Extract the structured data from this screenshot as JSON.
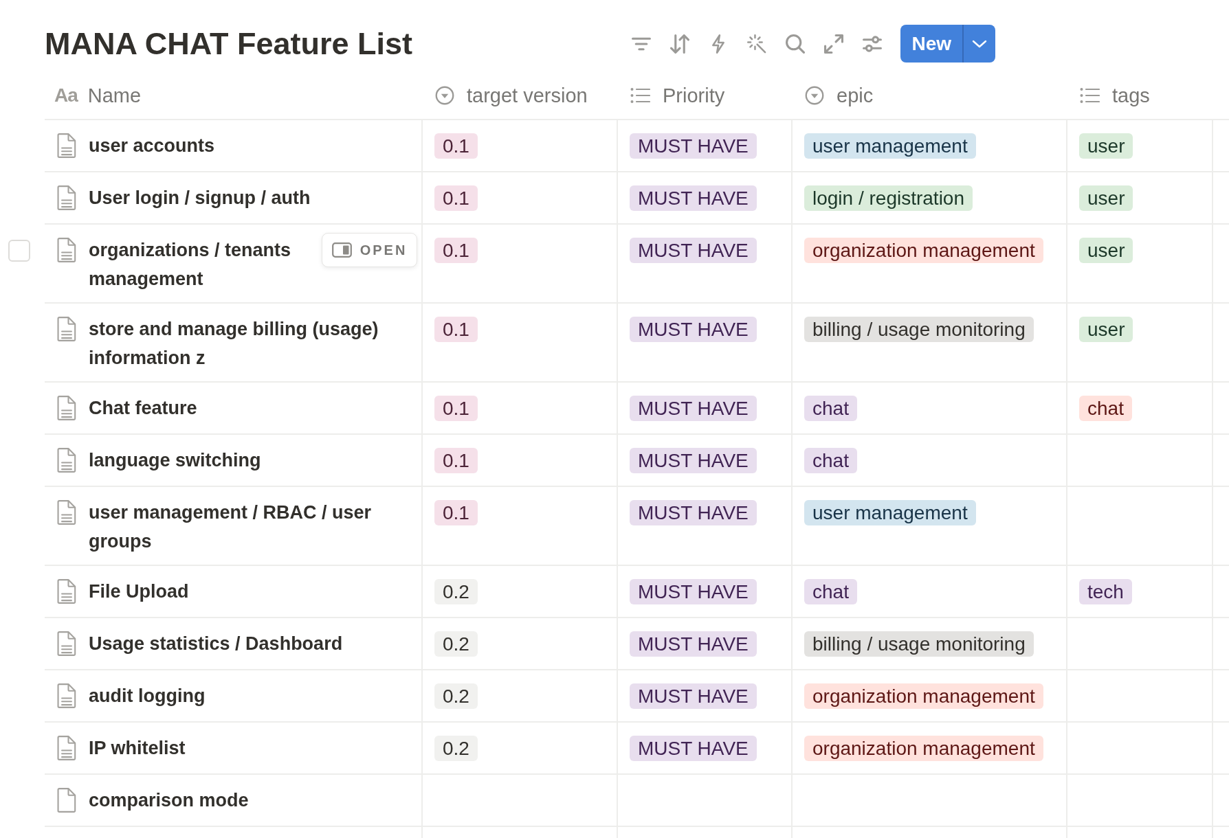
{
  "title": "MANA CHAT Feature List",
  "new_button": {
    "label": "New"
  },
  "open_button_label": "OPEN",
  "columns": [
    {
      "label": "Name",
      "kind": "title",
      "icon_glyph": "Aa"
    },
    {
      "label": "target version",
      "kind": "select"
    },
    {
      "label": "Priority",
      "kind": "multi_select"
    },
    {
      "label": "epic",
      "kind": "select"
    },
    {
      "label": "tags",
      "kind": "multi_select"
    }
  ],
  "rows": [
    {
      "name": "user accounts",
      "has_content": true,
      "hovered": false,
      "checked": false,
      "target_version": [
        {
          "label": "0.1",
          "color": "#f5e0e9"
        }
      ],
      "priority": [
        {
          "label": "MUST HAVE",
          "color": "#e8deee"
        }
      ],
      "epic": [
        {
          "label": "user management",
          "color": "#d3e5ef"
        }
      ],
      "tags": [
        {
          "label": "user",
          "color": "#dbeddb"
        }
      ]
    },
    {
      "name": "User login / signup / auth",
      "has_content": true,
      "hovered": false,
      "checked": false,
      "target_version": [
        {
          "label": "0.1",
          "color": "#f5e0e9"
        }
      ],
      "priority": [
        {
          "label": "MUST HAVE",
          "color": "#e8deee"
        }
      ],
      "epic": [
        {
          "label": "login / registration",
          "color": "#dbeddb"
        }
      ],
      "tags": [
        {
          "label": "user",
          "color": "#dbeddb"
        }
      ]
    },
    {
      "name": "organizations / tenants management",
      "has_content": true,
      "hovered": true,
      "checked": false,
      "target_version": [
        {
          "label": "0.1",
          "color": "#f5e0e9"
        }
      ],
      "priority": [
        {
          "label": "MUST HAVE",
          "color": "#e8deee"
        }
      ],
      "epic": [
        {
          "label": "organization management",
          "color": "#ffe2dd"
        }
      ],
      "tags": [
        {
          "label": "user",
          "color": "#dbeddb"
        }
      ]
    },
    {
      "name": "store and manage billing (usage) information z",
      "has_content": true,
      "hovered": false,
      "checked": false,
      "target_version": [
        {
          "label": "0.1",
          "color": "#f5e0e9"
        }
      ],
      "priority": [
        {
          "label": "MUST HAVE",
          "color": "#e8deee"
        }
      ],
      "epic": [
        {
          "label": "billing / usage monitoring",
          "color": "#e3e2e0"
        }
      ],
      "tags": [
        {
          "label": "user",
          "color": "#dbeddb"
        }
      ]
    },
    {
      "name": "Chat feature",
      "has_content": true,
      "hovered": false,
      "checked": false,
      "target_version": [
        {
          "label": "0.1",
          "color": "#f5e0e9"
        }
      ],
      "priority": [
        {
          "label": "MUST HAVE",
          "color": "#e8deee"
        }
      ],
      "epic": [
        {
          "label": "chat",
          "color": "#e8deee"
        }
      ],
      "tags": [
        {
          "label": "chat",
          "color": "#ffe2dd"
        }
      ]
    },
    {
      "name": "language switching",
      "has_content": true,
      "hovered": false,
      "checked": false,
      "target_version": [
        {
          "label": "0.1",
          "color": "#f5e0e9"
        }
      ],
      "priority": [
        {
          "label": "MUST HAVE",
          "color": "#e8deee"
        }
      ],
      "epic": [
        {
          "label": "chat",
          "color": "#e8deee"
        }
      ]
    },
    {
      "name": "user management / RBAC / user groups",
      "has_content": true,
      "hovered": false,
      "checked": false,
      "target_version": [
        {
          "label": "0.1",
          "color": "#f5e0e9"
        }
      ],
      "priority": [
        {
          "label": "MUST HAVE",
          "color": "#e8deee"
        }
      ],
      "epic": [
        {
          "label": "user management",
          "color": "#d3e5ef"
        }
      ]
    },
    {
      "name": "File Upload",
      "has_content": true,
      "hovered": false,
      "checked": false,
      "target_version": [
        {
          "label": "0.2",
          "color": "#f1f1ef"
        }
      ],
      "priority": [
        {
          "label": "MUST HAVE",
          "color": "#e8deee"
        }
      ],
      "epic": [
        {
          "label": "chat",
          "color": "#e8deee"
        }
      ],
      "tags": [
        {
          "label": "tech",
          "color": "#e8deee"
        }
      ]
    },
    {
      "name": "Usage statistics / Dashboard",
      "has_content": true,
      "hovered": false,
      "checked": false,
      "target_version": [
        {
          "label": "0.2",
          "color": "#f1f1ef"
        }
      ],
      "priority": [
        {
          "label": "MUST HAVE",
          "color": "#e8deee"
        }
      ],
      "epic": [
        {
          "label": "billing / usage monitoring",
          "color": "#e3e2e0"
        }
      ]
    },
    {
      "name": "audit logging",
      "has_content": true,
      "hovered": false,
      "checked": false,
      "target_version": [
        {
          "label": "0.2",
          "color": "#f1f1ef"
        }
      ],
      "priority": [
        {
          "label": "MUST HAVE",
          "color": "#e8deee"
        }
      ],
      "epic": [
        {
          "label": "organization management",
          "color": "#ffe2dd"
        }
      ]
    },
    {
      "name": "IP whitelist",
      "has_content": true,
      "hovered": false,
      "checked": false,
      "target_version": [
        {
          "label": "0.2",
          "color": "#f1f1ef"
        }
      ],
      "priority": [
        {
          "label": "MUST HAVE",
          "color": "#e8deee"
        }
      ],
      "epic": [
        {
          "label": "organization management",
          "color": "#ffe2dd"
        }
      ]
    },
    {
      "name": "comparison mode",
      "has_content": false,
      "hovered": false,
      "checked": false
    }
  ]
}
